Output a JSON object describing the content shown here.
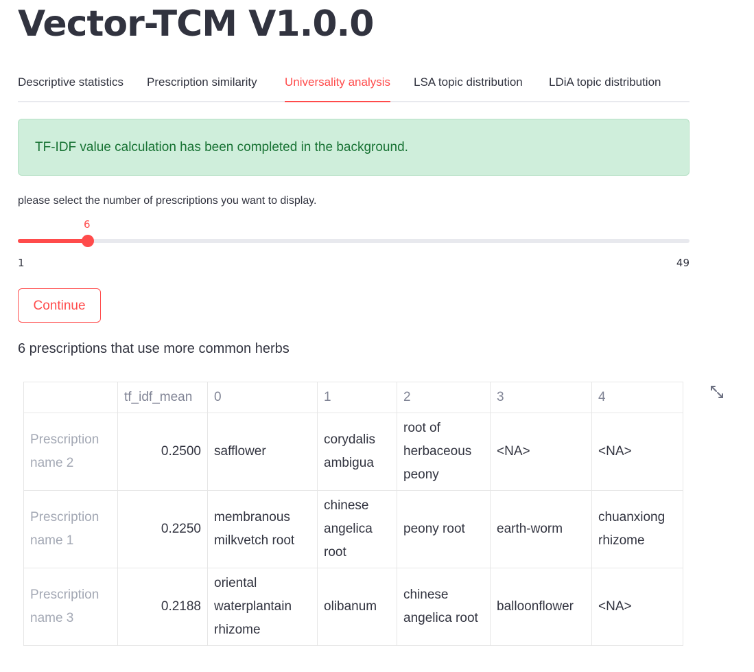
{
  "app": {
    "title": "Vector-TCM V1.0.0"
  },
  "tabs": [
    {
      "label": "Descriptive statistics",
      "active": false
    },
    {
      "label": "Prescription similarity",
      "active": false
    },
    {
      "label": "Universality analysis",
      "active": true
    },
    {
      "label": "LSA topic distribution",
      "active": false
    },
    {
      "label": "LDiA topic distribution",
      "active": false
    }
  ],
  "alert": {
    "text": "TF-IDF value calculation has been completed in the background."
  },
  "slider": {
    "prompt": "please select the number of prescriptions you want to display.",
    "value": "6",
    "min": "1",
    "max": "49"
  },
  "button": {
    "label": "Continue"
  },
  "result": {
    "heading": "6 prescriptions that use more common herbs"
  },
  "table": {
    "columns": [
      "",
      "tf_idf_mean",
      "0",
      "1",
      "2",
      "3",
      "4"
    ],
    "rows": [
      [
        "Prescription name 2",
        "0.2500",
        "safflower",
        "corydalis ambigua",
        "root of herbaceous peony",
        "<NA>",
        "<NA>"
      ],
      [
        "Prescription name 1",
        "0.2250",
        "membranous milkvetch root",
        "chinese angelica root",
        "peony root",
        "earth-worm",
        "chuanxiong rhizome"
      ],
      [
        "Prescription name 3",
        "0.2188",
        "oriental waterplantain rhizome",
        "olibanum",
        "chinese angelica root",
        "balloonflower",
        "<NA>"
      ]
    ]
  },
  "colors": {
    "accent": "#ff4b4b",
    "success_bg": "#cfeedb",
    "success_text": "#177233"
  }
}
